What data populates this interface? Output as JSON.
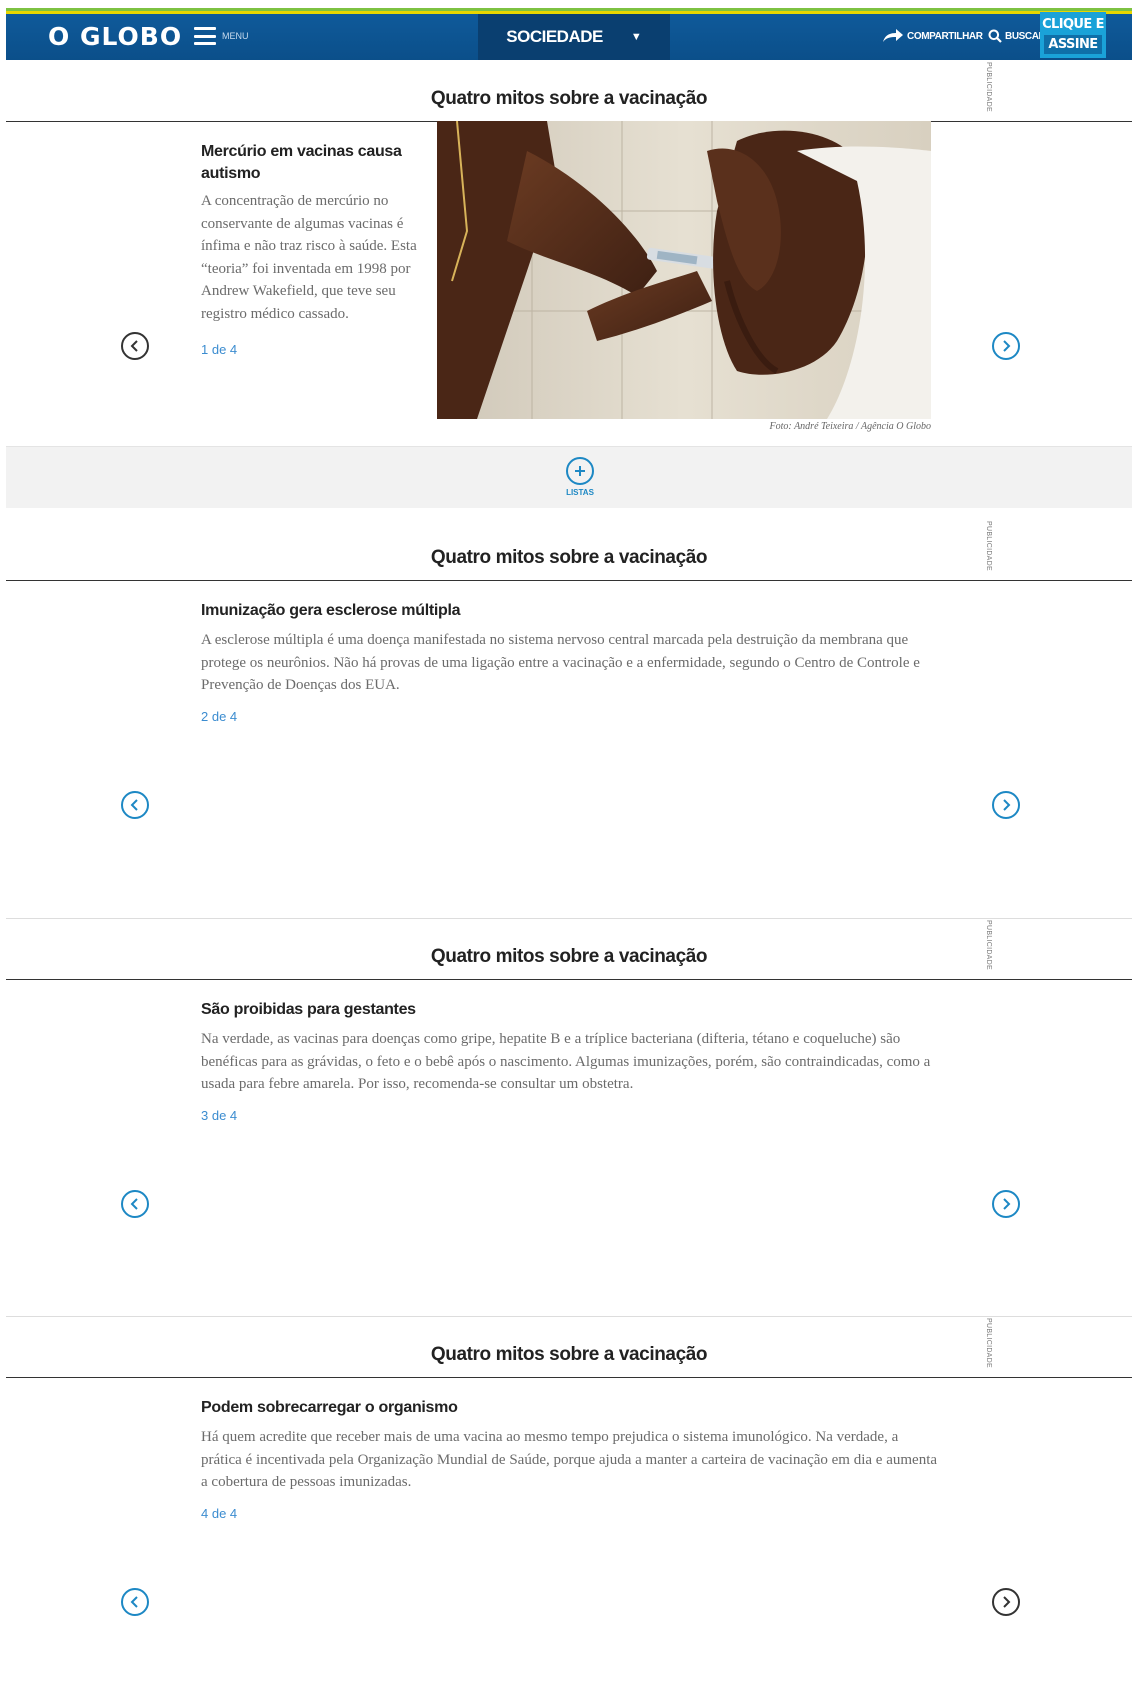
{
  "header": {
    "logo": "O GLOBO",
    "menu_label": "MENU",
    "section": "SOCIEDADE",
    "share_label": "COMPARTILHAR",
    "search_label": "BUSCAR",
    "subscribe_line1": "CLIQUE E",
    "subscribe_line2": "ASSINE"
  },
  "ad_label": "PUBLICIDADE",
  "lists_label": "LISTAS",
  "slides": [
    {
      "title": "Quatro mitos sobre a vacinação",
      "heading": "Mercúrio em vacinas causa autismo",
      "body": "A concentração de mercúrio no conservante de algumas vacinas é ínfima e não traz risco à saúde. Esta “teoria” foi inventada em 1998 por Andrew Wakefield, que teve seu registro médico cassado.",
      "counter": "1 de 4",
      "photo_credit": "Foto: André Teixeira / Agência O Globo"
    },
    {
      "title": "Quatro mitos sobre a vacinação",
      "heading": "Imunização gera esclerose múltipla",
      "body": "A esclerose múltipla é uma doença manifestada no sistema nervoso central marcada pela destruição da membrana que protege os neurônios. Não há provas de uma ligação entre a vacinação e a enfermidade, segundo o Centro de Controle e Prevenção de Doenças dos EUA.",
      "counter": "2 de 4"
    },
    {
      "title": "Quatro mitos sobre a vacinação",
      "heading": "São proibidas para gestantes",
      "body": "Na verdade, as vacinas para doenças como gripe, hepatite B e a tríplice bacteriana (difteria, tétano e coqueluche) são benéficas para as grávidas, o feto e o bebê após o nascimento. Algumas imunizações, porém, são contraindicadas, como a usada para febre amarela. Por isso, recomenda-se consultar um obstetra.",
      "counter": "3 de 4"
    },
    {
      "title": "Quatro mitos sobre a vacinação",
      "heading": "Podem sobrecarregar o organismo",
      "body": "Há quem acredite que receber mais de uma vacina ao mesmo tempo prejudica o sistema imunológico. Na verdade, a prática é incentivada pela Organização Mundial de Saúde, porque ajuda a manter a carteira de vacinação em dia e aumenta a cobertura de pessoas imunizadas.",
      "counter": "4 de 4"
    }
  ],
  "colors": {
    "header_blue": "#0b4f8a",
    "section_tab": "#0a3f70",
    "subscribe": "#1aa2d8",
    "accent_link": "#3b8cd0",
    "arrow_blue": "#1d88c4",
    "top_green": "#7dc242",
    "top_yellow": "#e8d600"
  }
}
